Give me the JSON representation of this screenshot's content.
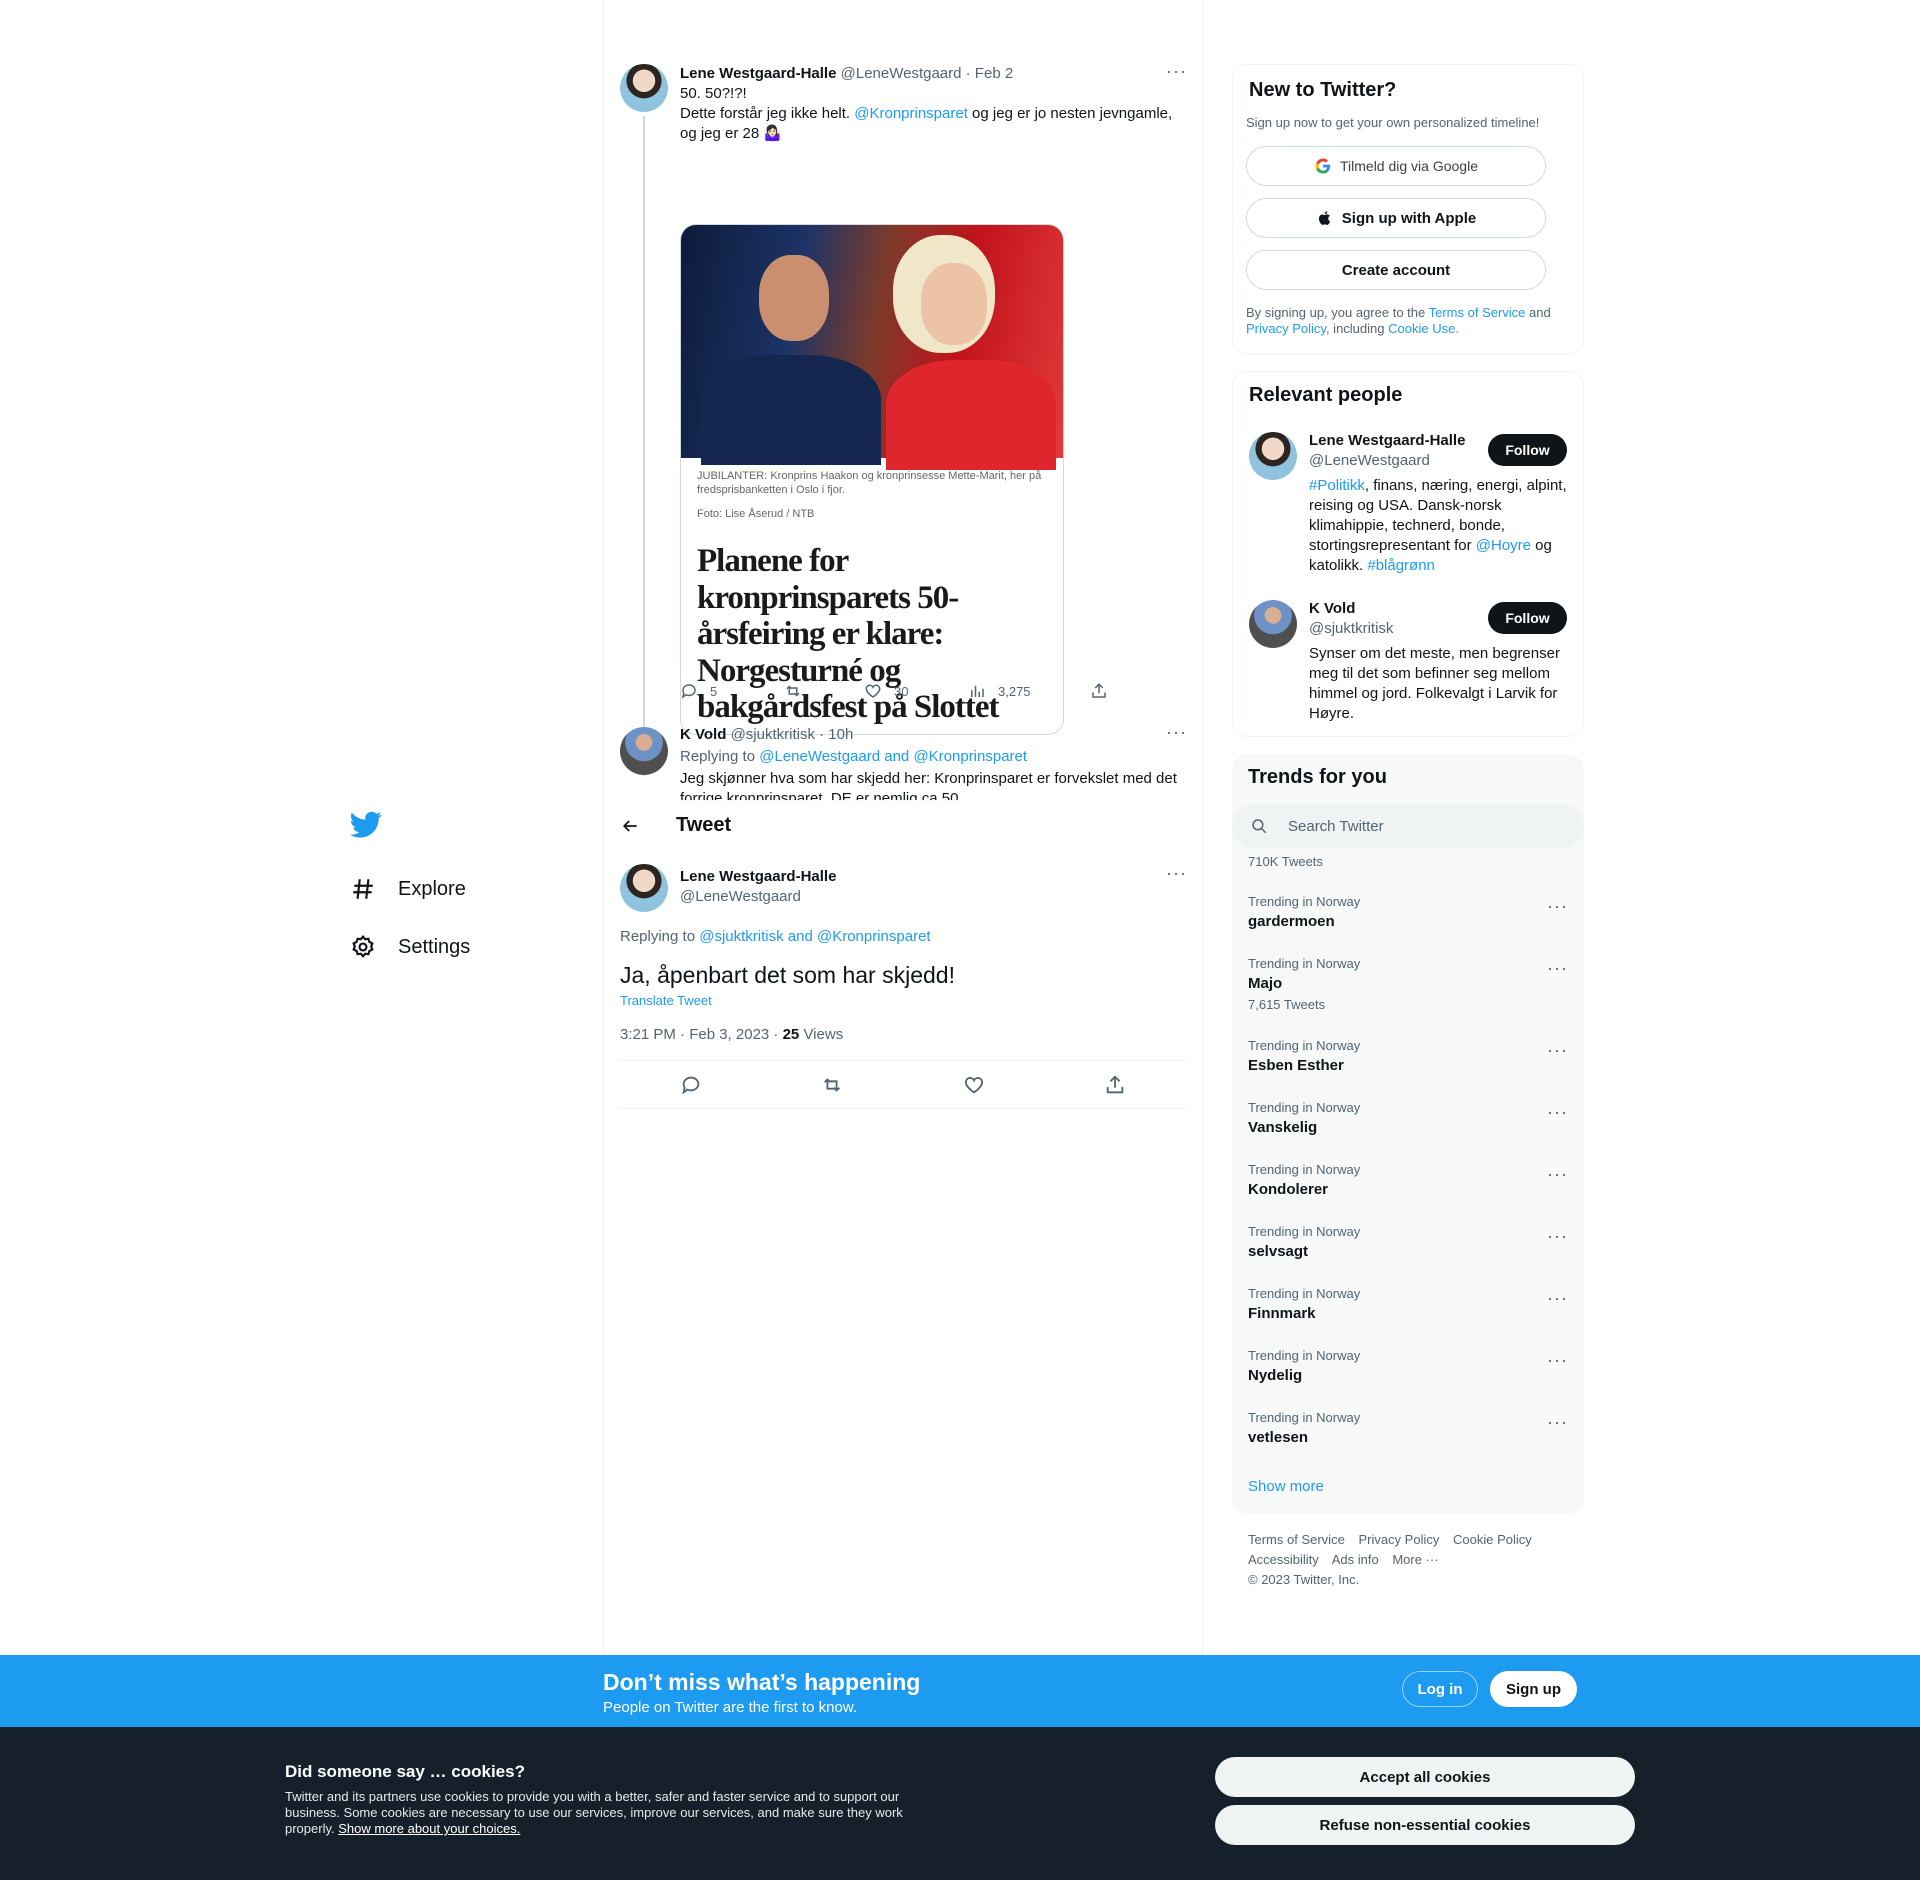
{
  "nav": {
    "items": [
      {
        "label": "Explore",
        "icon": "hash-icon"
      },
      {
        "label": "Settings",
        "icon": "gear-icon"
      }
    ]
  },
  "thread": {
    "tweet1": {
      "name": "Lene Westgaard-Halle",
      "meta": "@LeneWestgaard · Feb 2",
      "line1": "50. 50?!?!",
      "line2_pre": "Dette forstår jeg ikke helt. ",
      "line2_mention": "@Kronprinsparet",
      "line2_post": " og jeg er jo nesten jevngamle, og jeg er 28 🤷🏻‍♀️",
      "media": {
        "caption": "JUBILANTER: Kronprins Haakon og kronprinsesse Mette-Marit, her på fredsprisbanketten i Oslo i fjor.",
        "credit": "Foto: Lise Åserud / NTB",
        "headline": "Planene for kronprinsparets 50-årsfeiring er klare: Norgesturné og bakgårdsfest på Slottet"
      },
      "replies": "5",
      "likes": "30",
      "views": "3,275"
    },
    "tweet2": {
      "name": "K Vold",
      "meta": "@sjuktkritisk · 10h",
      "replying_label": "Replying to ",
      "replying_users": "@LeneWestgaard and @Kronprinsparet",
      "text": "Jeg skjønner hva som har skjedd her: Kronprinsparet er forvekslet med det forrige kronprinsparet. DE er nemlig ca 50."
    }
  },
  "header": {
    "title": "Tweet"
  },
  "focal": {
    "name": "Lene Westgaard-Halle",
    "handle": "@LeneWestgaard",
    "replying_label": "Replying to ",
    "replying_users": "@sjuktkritisk and @Kronprinsparet",
    "text": "Ja, åpenbart det som har skjedd!",
    "translate": "Translate Tweet",
    "timestamp": "3:21 PM · Feb 3, 2023 · ",
    "views_count": "25",
    "views_label": " Views"
  },
  "signup_card": {
    "title": "New to Twitter?",
    "subtitle": "Sign up now to get your own personalized timeline!",
    "google": "Tilmeld dig via Google",
    "apple": "Sign up with Apple",
    "create": "Create account",
    "legal_pre": "By signing up, you agree to the ",
    "terms": "Terms of Service",
    "and": " and ",
    "privacy": "Privacy Policy",
    "including": ", including ",
    "cookie": "Cookie Use."
  },
  "relevant": {
    "title": "Relevant people",
    "follow_label": "Follow",
    "people": [
      {
        "name": "Lene Westgaard-Halle",
        "handle": "@LeneWestgaard",
        "bio_tag": "#Politikk",
        "bio_mid": ", finans, næring, energi, alpint, reising og USA. Dansk-norsk klimahippie, technerd, bonde, stortingsrepresentant for ",
        "bio_mention": "@Hoyre",
        "bio_end": " og katolikk. ",
        "bio_tag2": "#blågrønn"
      },
      {
        "name": "K Vold",
        "handle": "@sjuktkritisk",
        "bio": "Synser om det meste, men begrenser meg til det som befinner seg mellom himmel og jord. Folkevalgt i Larvik for Høyre."
      }
    ]
  },
  "trends": {
    "title": "Trends for you",
    "search_placeholder": "Search Twitter",
    "partial_count": "710K Tweets",
    "items": [
      {
        "context": "Trending in Norway",
        "name": "gardermoen",
        "count": ""
      },
      {
        "context": "Trending in Norway",
        "name": "Majo",
        "count": "7,615 Tweets"
      },
      {
        "context": "Trending in Norway",
        "name": "Esben Esther",
        "count": ""
      },
      {
        "context": "Trending in Norway",
        "name": "Vanskelig",
        "count": ""
      },
      {
        "context": "Trending in Norway",
        "name": "Kondolerer",
        "count": ""
      },
      {
        "context": "Trending in Norway",
        "name": "selvsagt",
        "count": ""
      },
      {
        "context": "Trending in Norway",
        "name": "Finnmark",
        "count": ""
      },
      {
        "context": "Trending in Norway",
        "name": "Nydelig",
        "count": ""
      },
      {
        "context": "Trending in Norway",
        "name": "vetlesen",
        "count": ""
      }
    ],
    "show_more": "Show more"
  },
  "footer": {
    "links": [
      "Terms of Service",
      "Privacy Policy",
      "Cookie Policy",
      "Accessibility",
      "Ads info",
      "More ···"
    ],
    "copyright": "© 2023 Twitter, Inc."
  },
  "banner": {
    "headline": "Don’t miss what’s happening",
    "sub": "People on Twitter are the first to know.",
    "login": "Log in",
    "signup": "Sign up"
  },
  "cookies": {
    "title": "Did someone say … cookies?",
    "text": "Twitter and its partners use cookies to provide you with a better, safer and faster service and to support our business. Some cookies are necessary to use our services, improve our services, and make sure they work properly. ",
    "link": "Show more about your choices.",
    "accept": "Accept all cookies",
    "refuse": "Refuse non-essential cookies"
  },
  "colors": {
    "accent": "#1d9bf0",
    "text": "#0f1419",
    "muted": "#536471",
    "cookie_bg": "#15202b"
  }
}
